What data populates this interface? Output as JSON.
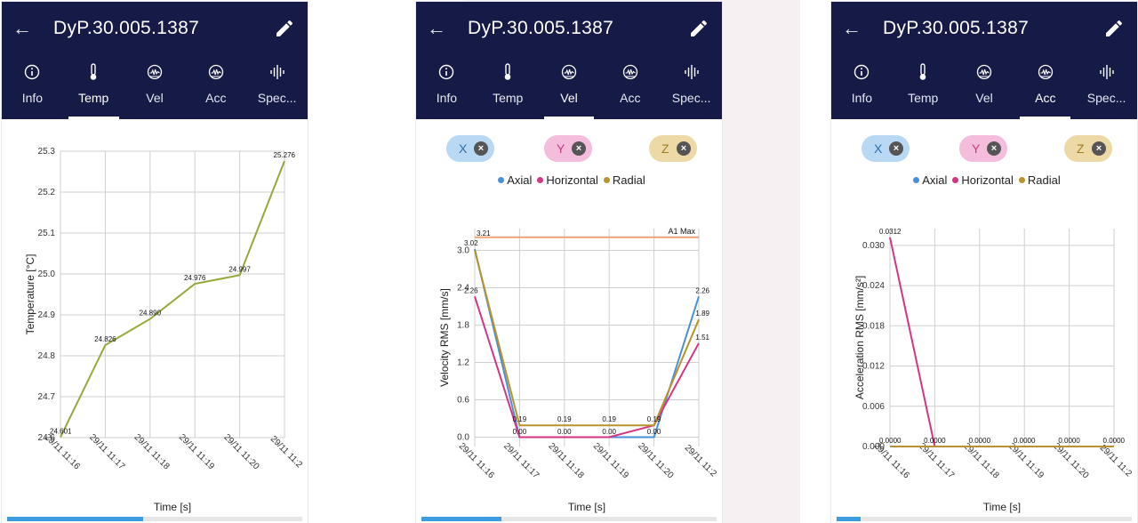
{
  "colors": {
    "header": "#151a47",
    "axial": "#4a90d9",
    "horizontal": "#d63384",
    "radial": "#b8932d",
    "temp_line": "#94a93a",
    "limit": "#f4a07a"
  },
  "screens": [
    {
      "title": "DyP.30.005.1387",
      "progress": 0.46,
      "active_tab": 1,
      "tabs": [
        {
          "label": "Info",
          "icon": "info-icon"
        },
        {
          "label": "Temp",
          "icon": "thermometer-icon"
        },
        {
          "label": "Vel",
          "icon": "vibration-icon"
        },
        {
          "label": "Acc",
          "icon": "vibration-icon"
        },
        {
          "label": "Spec...",
          "icon": "spectrum-icon"
        }
      ],
      "chart_data": {
        "type": "line",
        "ylabel": "Temperature [°C]",
        "xlabel": "Time [s]",
        "x": [
          "29/11 11:16",
          "29/11 11:17",
          "29/11 11:18",
          "29/11 11:19",
          "29/11 11:20",
          "29/11 11:2"
        ],
        "yticks": [
          "24.6",
          "24.7",
          "24.8",
          "24.9",
          "25.0",
          "25.1",
          "25.2",
          "25.3"
        ],
        "ylim": [
          24.6,
          25.3
        ],
        "series": [
          {
            "values": [
              24.601,
              24.826,
              24.89,
              24.976,
              24.997,
              25.276
            ],
            "labels": [
              "24.601",
              "24.826",
              "24.890",
              "24.976",
              "24.997",
              "25.276"
            ]
          }
        ]
      }
    },
    {
      "title": "DyP.30.005.1387",
      "progress": 0.27,
      "active_tab": 2,
      "tabs": [
        {
          "label": "Info",
          "icon": "info-icon"
        },
        {
          "label": "Temp",
          "icon": "thermometer-icon"
        },
        {
          "label": "Vel",
          "icon": "vibration-icon"
        },
        {
          "label": "Acc",
          "icon": "vibration-icon"
        },
        {
          "label": "Spec...",
          "icon": "spectrum-icon"
        }
      ],
      "chips": [
        "X",
        "Y",
        "Z"
      ],
      "legend": [
        "Axial",
        "Horizontal",
        "Radial"
      ],
      "chart_data": {
        "type": "line",
        "ylabel": "Velocity RMS [mm/s]",
        "xlabel": "Time [s]",
        "x": [
          "29/11 11:16",
          "29/11 11:17",
          "29/11 11:18",
          "29/11 11:19",
          "29/11 11:20",
          "29/11 11:2"
        ],
        "yticks": [
          "0.0",
          "0.6",
          "1.2",
          "1.8",
          "2.4",
          "3.0"
        ],
        "ylim": [
          -0.15,
          3.35
        ],
        "limit": {
          "label": "A1 Max",
          "value": 3.21,
          "value_label": "3.21"
        },
        "series": [
          {
            "name": "Axial",
            "values": [
              3.02,
              0.0,
              0.0,
              0.0,
              0.0,
              2.26
            ],
            "labels": [
              "3.02",
              "",
              "",
              "",
              "",
              "2.26"
            ]
          },
          {
            "name": "Horizontal",
            "values": [
              2.26,
              0.0,
              0.0,
              0.0,
              0.19,
              1.51
            ],
            "labels": [
              "2.26",
              "0.00",
              "0.00",
              "0.00",
              "0.00",
              "1.51"
            ]
          },
          {
            "name": "Radial",
            "values": [
              3.0,
              0.19,
              0.19,
              0.19,
              0.19,
              1.89
            ],
            "labels": [
              "",
              "0.19",
              "0.19",
              "0.19",
              "0.19",
              "1.89"
            ]
          }
        ]
      }
    },
    {
      "title": "DyP.30.005.1387",
      "progress": 0.08,
      "active_tab": 3,
      "tabs": [
        {
          "label": "Info",
          "icon": "info-icon"
        },
        {
          "label": "Temp",
          "icon": "thermometer-icon"
        },
        {
          "label": "Vel",
          "icon": "vibration-icon"
        },
        {
          "label": "Acc",
          "icon": "vibration-icon"
        },
        {
          "label": "Spec...",
          "icon": "spectrum-icon"
        }
      ],
      "chips": [
        "X",
        "Y",
        "Z"
      ],
      "legend": [
        "Axial",
        "Horizontal",
        "Radial"
      ],
      "chart_data": {
        "type": "line",
        "ylabel": "Acceleration RMS [mm/s²]",
        "xlabel": "Time [s]",
        "x": [
          "29/11 11:16",
          "29/11 11:17",
          "29/11 11:18",
          "29/11 11:19",
          "29/11 11:20",
          "29/11 11:2"
        ],
        "yticks": [
          "0.000",
          "0.006",
          "0.012",
          "0.018",
          "0.024",
          "0.030"
        ],
        "ylim": [
          0,
          0.0325
        ],
        "series": [
          {
            "name": "Axial",
            "values": [
              0,
              0,
              0,
              0,
              0,
              0
            ],
            "labels": [
              "",
              "",
              "",
              "",
              "",
              ""
            ]
          },
          {
            "name": "Horizontal",
            "values": [
              0.0312,
              0,
              0,
              0,
              0,
              0
            ],
            "labels": [
              "0.0312",
              "",
              "",
              "",
              "",
              ""
            ]
          },
          {
            "name": "Radial",
            "values": [
              0,
              0,
              0,
              0,
              0,
              0
            ],
            "labels": [
              "0.0000",
              "0.0000",
              "0.0000",
              "0.0000",
              "0.0000",
              "0.0000"
            ]
          }
        ]
      }
    }
  ]
}
